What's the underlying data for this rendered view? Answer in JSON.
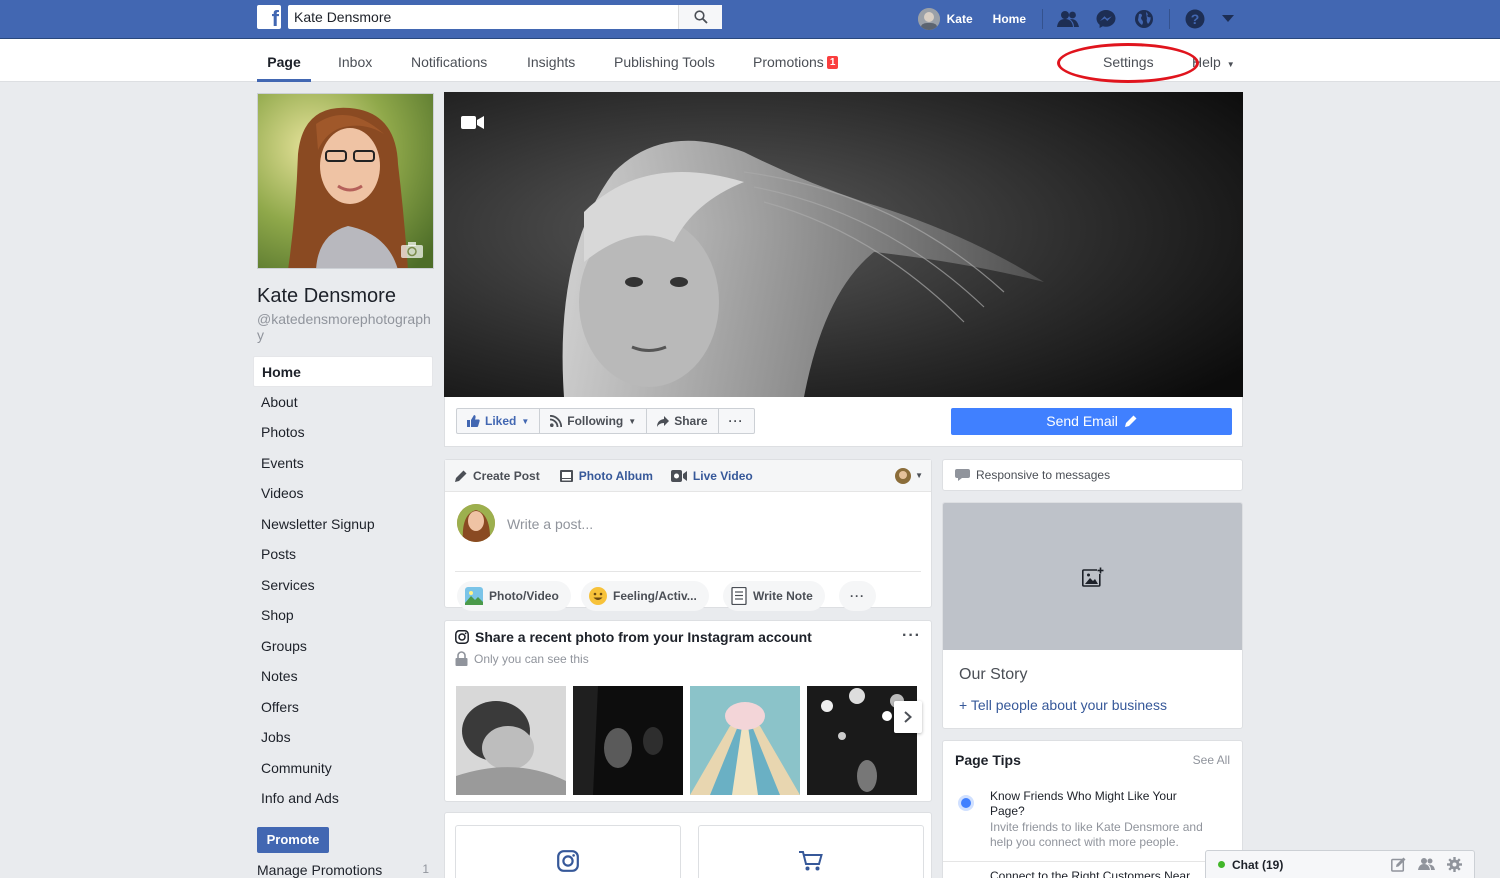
{
  "topbar": {
    "search_value": "Kate Densmore",
    "user_name": "Kate",
    "home_label": "Home"
  },
  "page_nav": {
    "tabs": [
      "Page",
      "Inbox",
      "Notifications",
      "Insights",
      "Publishing Tools",
      "Promotions"
    ],
    "promotions_badge": "1",
    "settings_label": "Settings",
    "help_label": "Help"
  },
  "profile": {
    "name": "Kate Densmore",
    "handle": "@katedensmorephotography"
  },
  "sidebar": {
    "items": [
      "Home",
      "About",
      "Photos",
      "Events",
      "Videos",
      "Newsletter Signup",
      "Posts",
      "Services",
      "Shop",
      "Groups",
      "Notes",
      "Offers",
      "Jobs",
      "Community",
      "Info and Ads"
    ],
    "promote_label": "Promote",
    "manage_promotions_label": "Manage Promotions",
    "manage_promotions_count": "1"
  },
  "actions": {
    "liked": "Liked",
    "following": "Following",
    "share": "Share",
    "more": "···",
    "send_email": "Send Email"
  },
  "composer": {
    "tabs": [
      "Create Post",
      "Photo Album",
      "Live Video"
    ],
    "placeholder": "Write a post...",
    "chips": [
      "Photo/Video",
      "Feeling/Activ...",
      "Write Note"
    ],
    "more": "···"
  },
  "instagram": {
    "title": "Share a recent photo from your Instagram account",
    "subtitle": "Only you can see this",
    "more": "···"
  },
  "right": {
    "responsive": "Responsive to messages",
    "story_title": "Our Story",
    "story_link": "+ Tell people about your business",
    "tips_title": "Page Tips",
    "tips_see_all": "See All",
    "tip_title": "Know Friends Who Might Like Your Page?",
    "tip_body": "Invite friends to like Kate Densmore and help you connect with more people.",
    "tip_next": "Connect to the Right Customers Near"
  },
  "chat": {
    "label": "Chat (19)"
  },
  "colors": {
    "brand": "#4267b2",
    "send_email": "#4080ff",
    "highlight_ring": "#e0141d",
    "badge": "#fa3e3e"
  }
}
